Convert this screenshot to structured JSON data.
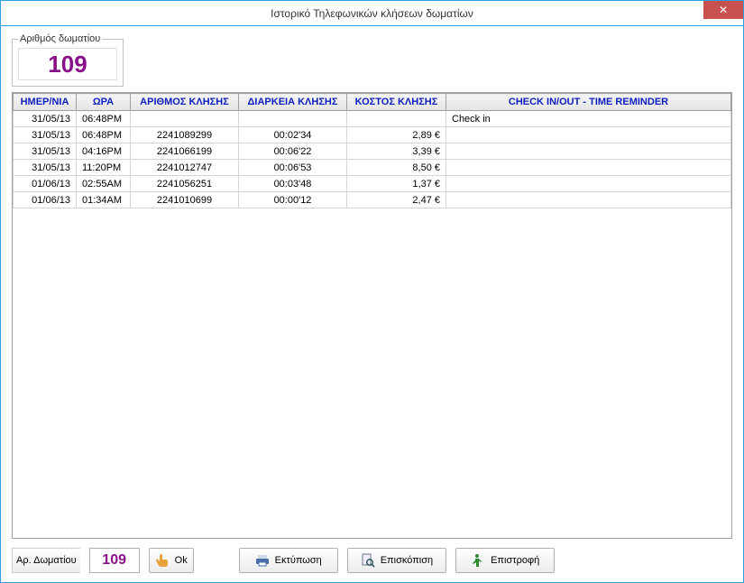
{
  "window": {
    "title": "Ιστορικό Τηλεφωνικών κλήσεων δωματίων"
  },
  "room": {
    "legend": "Αριθμός δωματίου",
    "number": "109"
  },
  "table": {
    "headers": {
      "date": "ΗΜΕΡ/ΝΙΑ",
      "time": "ΩΡΑ",
      "number": "ΑΡΙΘΜΟΣ ΚΛΗΣΗΣ",
      "duration": "ΔΙΑΡΚΕΙΑ ΚΛΗΣΗΣ",
      "cost": "ΚΟΣΤΟΣ ΚΛΗΣΗΣ",
      "note": "CHECK IN/OUT  -  TIME REMINDER"
    },
    "rows": [
      {
        "date": "31/05/13",
        "time": "06:48PM",
        "number": "",
        "duration": "",
        "cost": "",
        "note": "Check in"
      },
      {
        "date": "31/05/13",
        "time": "06:48PM",
        "number": "2241089299",
        "duration": "00:02'34",
        "cost": "2,89 €",
        "note": ""
      },
      {
        "date": "31/05/13",
        "time": "04:16PM",
        "number": "2241066199",
        "duration": "00:06'22",
        "cost": "3,39 €",
        "note": ""
      },
      {
        "date": "31/05/13",
        "time": "11:20PM",
        "number": "2241012747",
        "duration": "00:06'53",
        "cost": "8,50 €",
        "note": ""
      },
      {
        "date": "01/06/13",
        "time": "02:55AM",
        "number": "2241056251",
        "duration": "00:03'48",
        "cost": "1,37 €",
        "note": ""
      },
      {
        "date": "01/06/13",
        "time": "01:34AM",
        "number": "2241010699",
        "duration": "00:00'12",
        "cost": "2,47 €",
        "note": ""
      }
    ]
  },
  "footer": {
    "room_label": "Αρ. Δωματίου",
    "room_value": "109",
    "ok": "Ok",
    "print": "Εκτύπωση",
    "preview": "Επισκόπιση",
    "return": "Επιστροφή"
  }
}
